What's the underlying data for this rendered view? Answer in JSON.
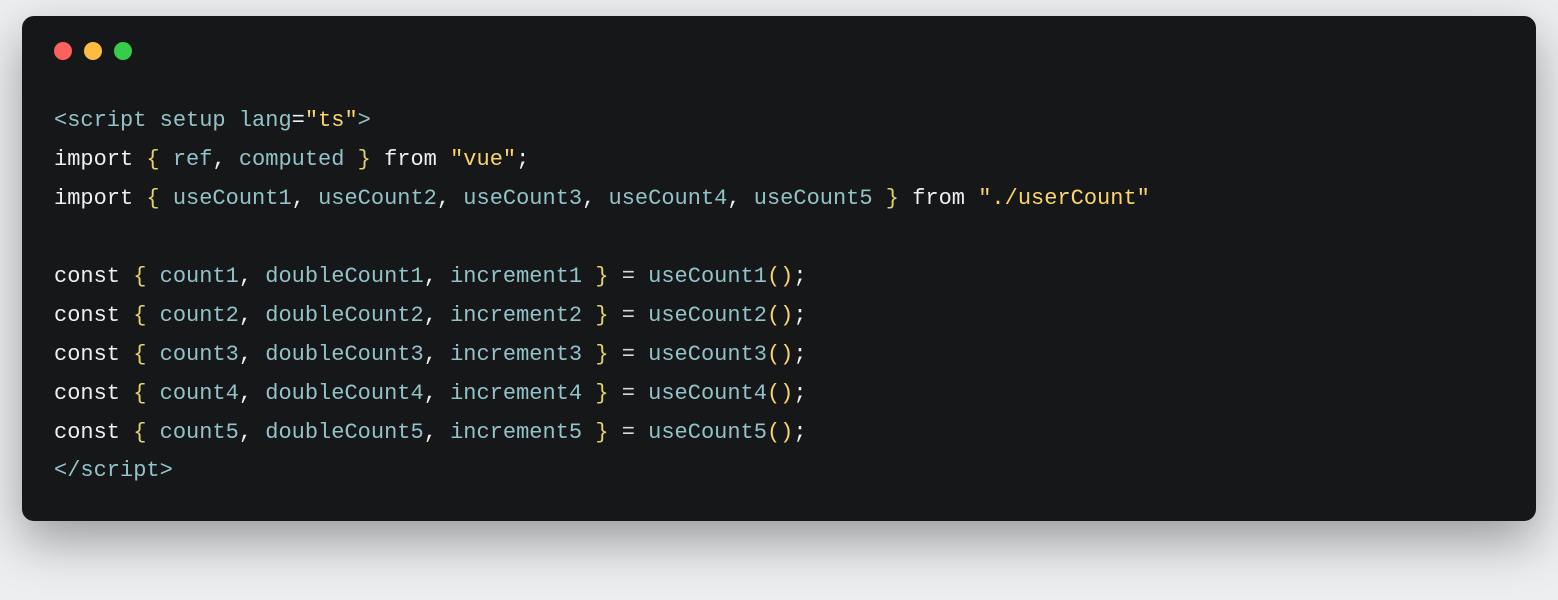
{
  "window": {
    "traffic_lights": {
      "red": "#fc625d",
      "yellow": "#fdbc40",
      "green": "#35cd4b"
    }
  },
  "code": {
    "l1": {
      "open": "<",
      "tag": "script",
      "sp": " ",
      "attr1": "setup",
      "sp2": " ",
      "attr2": "lang",
      "eq": "=",
      "q1": "\"",
      "val": "ts",
      "q2": "\"",
      "close": ">"
    },
    "l2": {
      "import": "import",
      "sp": " ",
      "ob": "{",
      "sp2": " ",
      "id1": "ref",
      "comma": ",",
      "sp3": " ",
      "id2": "computed",
      "sp4": " ",
      "cb": "}",
      "sp5": " ",
      "from": "from",
      "sp6": " ",
      "q1": "\"",
      "mod": "vue",
      "q2": "\"",
      "semi": ";"
    },
    "l3": {
      "import": "import",
      "sp": " ",
      "ob": "{",
      "sp2": " ",
      "id1": "useCount1",
      "c1": ",",
      "sp3": " ",
      "id2": "useCount2",
      "c2": ",",
      "sp4": " ",
      "id3": "useCount3",
      "c3": ",",
      "sp5": " ",
      "id4": "useCount4",
      "c4": ",",
      "sp6": " ",
      "id5": "useCount5",
      "sp7": " ",
      "cb": "}",
      "sp8": " ",
      "from": "from",
      "sp9": " ",
      "q1": "\"",
      "mod": "./userCount",
      "q2": "\""
    },
    "l5": {
      "const": "const",
      "sp": " ",
      "ob": "{",
      "sp2": " ",
      "id1": "count1",
      "c1": ",",
      "sp3": " ",
      "id2": "doubleCount1",
      "c2": ",",
      "sp4": " ",
      "id3": "increment1",
      "sp5": " ",
      "cb": "}",
      "sp6": " ",
      "eq": "=",
      "sp7": " ",
      "fn": "useCount1",
      "paren": "()",
      "semi": ";"
    },
    "l6": {
      "const": "const",
      "sp": " ",
      "ob": "{",
      "sp2": " ",
      "id1": "count2",
      "c1": ",",
      "sp3": " ",
      "id2": "doubleCount2",
      "c2": ",",
      "sp4": " ",
      "id3": "increment2",
      "sp5": " ",
      "cb": "}",
      "sp6": " ",
      "eq": "=",
      "sp7": " ",
      "fn": "useCount2",
      "paren": "()",
      "semi": ";"
    },
    "l7": {
      "const": "const",
      "sp": " ",
      "ob": "{",
      "sp2": " ",
      "id1": "count3",
      "c1": ",",
      "sp3": " ",
      "id2": "doubleCount3",
      "c2": ",",
      "sp4": " ",
      "id3": "increment3",
      "sp5": " ",
      "cb": "}",
      "sp6": " ",
      "eq": "=",
      "sp7": " ",
      "fn": "useCount3",
      "paren": "()",
      "semi": ";"
    },
    "l8": {
      "const": "const",
      "sp": " ",
      "ob": "{",
      "sp2": " ",
      "id1": "count4",
      "c1": ",",
      "sp3": " ",
      "id2": "doubleCount4",
      "c2": ",",
      "sp4": " ",
      "id3": "increment4",
      "sp5": " ",
      "cb": "}",
      "sp6": " ",
      "eq": "=",
      "sp7": " ",
      "fn": "useCount4",
      "paren": "()",
      "semi": ";"
    },
    "l9": {
      "const": "const",
      "sp": " ",
      "ob": "{",
      "sp2": " ",
      "id1": "count5",
      "c1": ",",
      "sp3": " ",
      "id2": "doubleCount5",
      "c2": ",",
      "sp4": " ",
      "id3": "increment5",
      "sp5": " ",
      "cb": "}",
      "sp6": " ",
      "eq": "=",
      "sp7": " ",
      "fn": "useCount5",
      "paren": "()",
      "semi": ";"
    },
    "l10": {
      "open": "</",
      "tag": "script",
      "close": ">"
    }
  }
}
